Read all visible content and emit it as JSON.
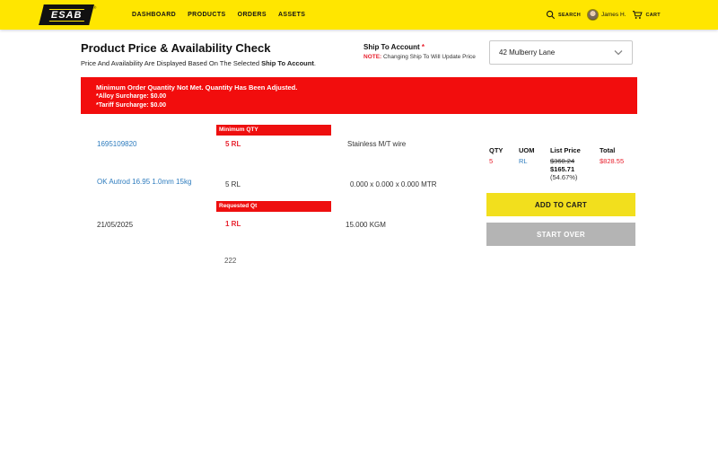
{
  "header": {
    "logo_text": "ESAB",
    "logo_reg": "®",
    "nav": [
      {
        "label": "DASHBOARD"
      },
      {
        "label": "PRODUCTS"
      },
      {
        "label": "ORDERS"
      },
      {
        "label": "ASSETS"
      }
    ],
    "search_label": "SEARCH",
    "user_name": "James H.",
    "cart_label": "CART"
  },
  "page": {
    "title": "Product Price & Availability Check",
    "subtitle_prefix": "Price And Availability Are Displayed Based On The Selected ",
    "subtitle_bold": "Ship To Account",
    "subtitle_suffix": "."
  },
  "ship_to": {
    "label": "Ship To Account ",
    "required_mark": "*",
    "note_label": "NOTE:",
    "note_text": " Changing Ship To Will Update Price",
    "selected_value": "42 Mulberry Lane"
  },
  "alert": {
    "line1": "Minimum Order Quantity Not Met. Quantity Has Been Adjusted.",
    "line2": "*Alloy Surcharge: $0.00",
    "line3": "*Tariff Surcharge: $0.00"
  },
  "product": {
    "number": "1695109820",
    "name": "OK Autrod 16.95 1.0mm 15kg",
    "date": "21/05/2025",
    "min_qty_label": "Minimum QTY",
    "min_qty_value": "5 RL",
    "qty_plain": "5 RL",
    "requested_label": "Requested Qt",
    "requested_value": "1 RL",
    "extra_qty": "222",
    "description": "Stainless M/T wire",
    "dimensions": "0.000 x 0.000 x 0.000 MTR",
    "weight": "15.000 KGM"
  },
  "price_table": {
    "headers": [
      "QTY",
      "UOM",
      "List Price",
      "Total"
    ],
    "qty": "5",
    "uom": "RL",
    "list_price_original": "$360.24",
    "list_price_current": "$165.71",
    "discount_pct": "(54.67%)",
    "total": "$828.55"
  },
  "actions": {
    "add_to_cart": "ADD TO CART",
    "start_over": "START OVER"
  },
  "colors": {
    "brand_yellow": "#FFE600",
    "alert_red": "#F20D0D",
    "text_red": "#E8212E",
    "link_blue": "#2E7CBE",
    "button_yellow": "#F2DF1D",
    "button_gray": "#B4B4B4"
  }
}
